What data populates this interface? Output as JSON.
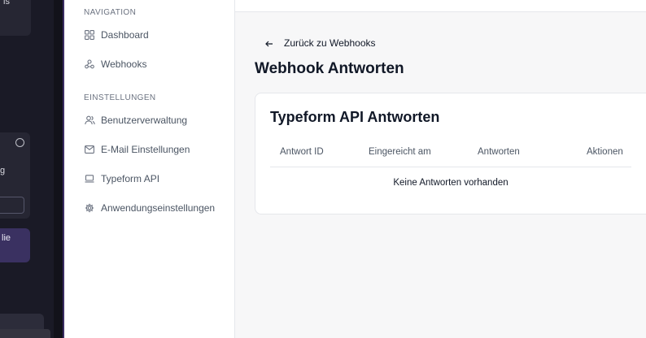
{
  "background_app": {
    "card_text_1": "ls",
    "card_text_2": "g",
    "card_text_3": "lie"
  },
  "sidebar": {
    "sections": [
      {
        "heading": "NAVIGATION",
        "items": [
          {
            "label": "Dashboard",
            "icon": "grid-icon"
          },
          {
            "label": "Webhooks",
            "icon": "webhook-icon"
          }
        ]
      },
      {
        "heading": "EINSTELLUNGEN",
        "items": [
          {
            "label": "Benutzerverwaltung",
            "icon": "users-icon"
          },
          {
            "label": "E-Mail Einstellungen",
            "icon": "mail-icon"
          },
          {
            "label": "Typeform API",
            "icon": "laptop-icon"
          },
          {
            "label": "Anwendungseinstellungen",
            "icon": "gear-icon"
          }
        ]
      }
    ]
  },
  "main": {
    "back_label": "Zurück zu Webhooks",
    "page_title": "Webhook Antworten",
    "card": {
      "title": "Typeform API Antworten",
      "columns": [
        "Antwort ID",
        "Eingereicht am",
        "Antworten",
        "Aktionen"
      ],
      "empty_message": "Keine Antworten vorhanden"
    }
  },
  "colors": {
    "dark_background": "#1a1a26",
    "accent_purple": "#3a3161",
    "text_primary": "#111827",
    "text_muted": "#4b5563"
  }
}
